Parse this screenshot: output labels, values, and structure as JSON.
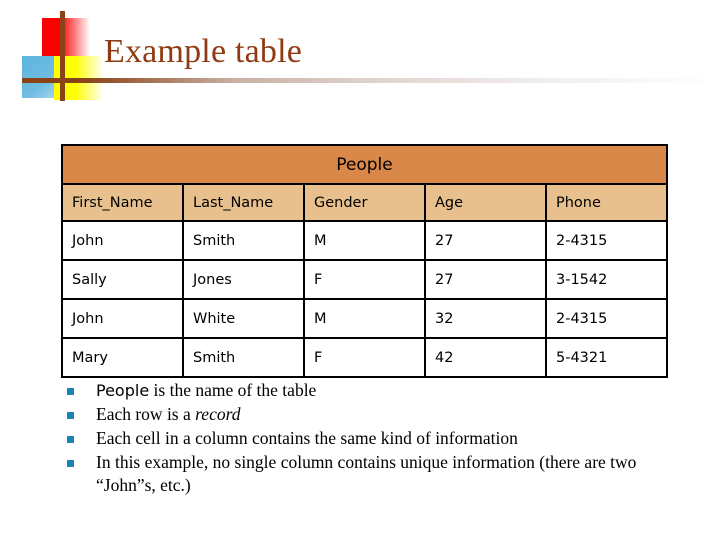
{
  "slide": {
    "title": "Example table",
    "logo": {
      "red_square": "#fb0000",
      "blue_square": "#5cb4dd",
      "yellow_square": "#ffff00",
      "cross": "#8a4316"
    },
    "title_color": "#8f3a12",
    "rule_color": "#8a4316"
  },
  "table": {
    "caption": "People",
    "caption_bg": "#d9884a",
    "header_bg": "#e7c08d",
    "border_color": "#000000",
    "columns": [
      "First_Name",
      "Last_Name",
      "Gender",
      "Age",
      "Phone"
    ],
    "rows": [
      {
        "first_name": "John",
        "last_name": "Smith",
        "gender": "M",
        "age": "27",
        "phone": "2-4315"
      },
      {
        "first_name": "Sally",
        "last_name": "Jones",
        "gender": "F",
        "age": "27",
        "phone": "3-1542"
      },
      {
        "first_name": "John",
        "last_name": "White",
        "gender": "M",
        "age": "32",
        "phone": "2-4315"
      },
      {
        "first_name": "Mary",
        "last_name": "Smith",
        "gender": "F",
        "age": "42",
        "phone": "5-4321"
      }
    ]
  },
  "notes": {
    "bullet_color": "#1a84b4",
    "items": [
      {
        "lead": "People",
        "rest": " is the name of the table",
        "emphasis": ""
      },
      {
        "lead": "",
        "rest": "Each row is a ",
        "emphasis": "record"
      },
      {
        "lead": "",
        "rest": "Each cell in a column contains the same kind of information",
        "emphasis": ""
      },
      {
        "lead": "",
        "rest": "In this example, no single column contains unique information (there are two “John”s, etc.)",
        "emphasis": ""
      }
    ]
  }
}
